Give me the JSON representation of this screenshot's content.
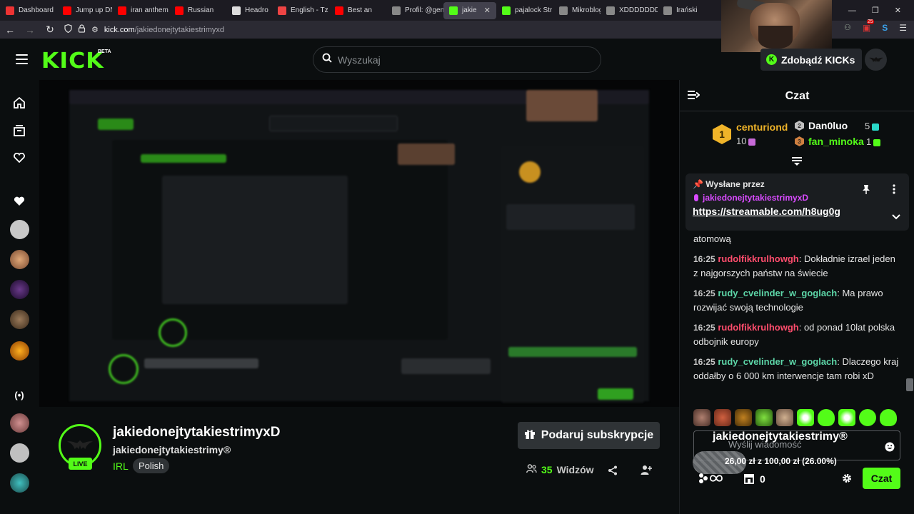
{
  "browser": {
    "tabs": [
      {
        "label": "Dashboard",
        "color": "#e33",
        "width": 80
      },
      {
        "label": "Jump up DN",
        "color": "#f00",
        "width": 77
      },
      {
        "label": "iran anthem",
        "color": "#f00",
        "width": 80
      },
      {
        "label": "Russian",
        "color": "#f00",
        "width": 80
      },
      {
        "label": "Headro",
        "color": "#ddd",
        "width": 64
      },
      {
        "label": "English - Tz",
        "color": "#e44",
        "width": 80
      },
      {
        "label": "Best an",
        "color": "#f00",
        "width": 80
      },
      {
        "label": "Profil: @gen",
        "color": "#888",
        "width": 80
      },
      {
        "label": "jakie",
        "color": "#53fc18",
        "width": 74,
        "active": true
      },
      {
        "label": "pajalock Str",
        "color": "#53fc18",
        "width": 80
      },
      {
        "label": "Mikroblog :",
        "color": "#888",
        "width": 66
      },
      {
        "label": "XDDDDDDD",
        "color": "#888",
        "width": 80
      },
      {
        "label": "Irański",
        "color": "#888",
        "width": 60
      }
    ],
    "url_host": "kick.com",
    "url_path": "/jakiedonejtytakiestrimyxd",
    "ext_badge": "25"
  },
  "header": {
    "logo": "KICK",
    "beta": "BETA",
    "search_placeholder": "Wyszukaj",
    "get_kicks": "Zdobądź KICKs"
  },
  "stream": {
    "username": "jakiedonejtytakiestrimyxD",
    "title": "jakiedonejtytakiestrimy®",
    "category": "IRL",
    "language": "Polish",
    "live": "LIVE",
    "gift_label": "Podaruj subskrypcje",
    "viewers_count": "35",
    "viewers_label": "Widzów"
  },
  "chat": {
    "title": "Czat",
    "leaderboard": {
      "first": {
        "rank": "1",
        "name": "centuriond",
        "count": "10"
      },
      "second": {
        "rank": "2",
        "name": "Dan0luo",
        "count": "5"
      },
      "third": {
        "rank": "3",
        "name": "fan_minoka",
        "count": "1"
      }
    },
    "pinned": {
      "by_label": "Wysłane przez",
      "user": "jakiedonejtytakiestrimyxD",
      "link": "https://streamable.com/h8ug0g"
    },
    "messages": [
      {
        "time": "",
        "user": "",
        "color": "#e6e6e6",
        "text": "atomową"
      },
      {
        "time": "16:25",
        "user": "rudolfikkrulhowgh",
        "color": "#ff4d6d",
        "text": "Dokładnie izrael jeden z najgorszych państw na świecie"
      },
      {
        "time": "16:25",
        "user": "rudy_cvelinder_w_goglach",
        "color": "#5dd6a8",
        "text": "Ma prawo rozwijać swoją technologie"
      },
      {
        "time": "16:25",
        "user": "rudolfikkrulhowgh",
        "color": "#ff4d6d",
        "text": "od ponad 10lat polska odbojnik europy"
      },
      {
        "time": "16:25",
        "user": "rudy_cvelinder_w_goglach",
        "color": "#5dd6a8",
        "text": "Dlaczego kraj oddałby o 6 000 km interwencje tam robi xD"
      }
    ],
    "input_placeholder": "Wyślij wiadomość",
    "goal_name": "jakiedonejtytakiestrimy®",
    "goal_amount": "26,00 zł z 100,00 zł (26.00%)",
    "goal_progress": 0.26,
    "kicks_count": "0",
    "send_label": "Czat"
  }
}
